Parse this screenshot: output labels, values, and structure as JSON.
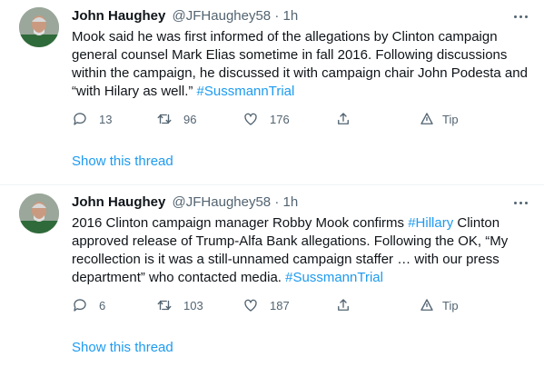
{
  "tweets": [
    {
      "name": "John Haughey",
      "handle": "@JFHaughey58",
      "dot": "·",
      "time": "1h",
      "text_plain": "Mook said he was first informed of the allegations by Clinton campaign general counsel Mark Elias sometime in fall 2016. Following discussions within the campaign, he discussed it with campaign chair John Podesta and “with Hilary as well.” ",
      "text_tag": "#SussmannTrial",
      "replies": "13",
      "retweets": "96",
      "likes": "176",
      "tip": "Tip",
      "show_thread": "Show this thread"
    },
    {
      "name": "John Haughey",
      "handle": "@JFHaughey58",
      "dot": "·",
      "time": "1h",
      "text_part1": "2016 Clinton campaign manager Robby Mook confirms ",
      "text_tag1": "#Hillary",
      "text_part2": " Clinton approved release of Trump-Alfa Bank allegations. Following the OK, “My recollection is it was a still-unnamed campaign staffer … with our press department” who contacted media. ",
      "text_tag2": "#SussmannTrial",
      "replies": "6",
      "retweets": "103",
      "likes": "187",
      "tip": "Tip",
      "show_thread": "Show this thread"
    }
  ],
  "colors": {
    "accent": "#1d9bf0",
    "muted": "#536471",
    "text": "#0f1419"
  },
  "icons": [
    "reply-icon",
    "retweet-icon",
    "like-icon",
    "share-icon",
    "tip-icon",
    "more-icon"
  ]
}
